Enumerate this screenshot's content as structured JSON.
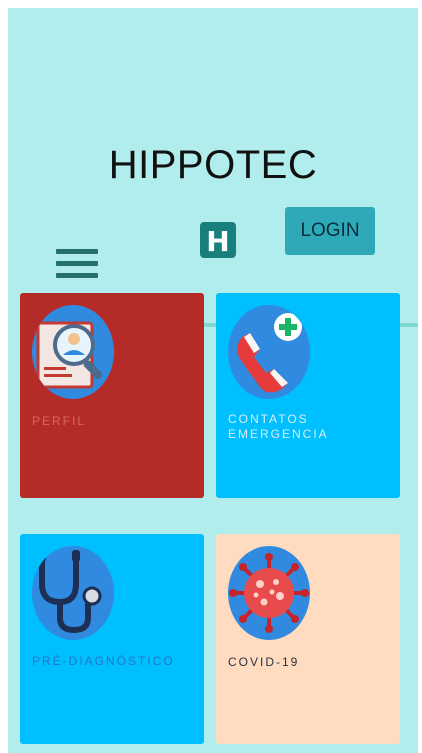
{
  "app": {
    "title": "HIPPOTEC",
    "logo_letter": "H"
  },
  "header": {
    "login_label": "LOGIN",
    "menu_icon": "hamburger-menu-icon"
  },
  "cards": [
    {
      "label": "PERFIL",
      "icon": "profile-search-icon",
      "color": "#b52b28"
    },
    {
      "label": "CONTATOS EMERGENCIA",
      "icon": "emergency-phone-icon",
      "color": "#00bfff"
    },
    {
      "label": "PRÉ-DIAGNÓSTICO",
      "icon": "stethoscope-icon",
      "color": "#00bfff"
    },
    {
      "label": "COVID-19",
      "icon": "virus-icon",
      "color": "#ffdcbf"
    }
  ],
  "colors": {
    "background": "#b2eded",
    "accent": "#2fa9b8",
    "menu": "#23706f",
    "logo": "#17807d"
  }
}
